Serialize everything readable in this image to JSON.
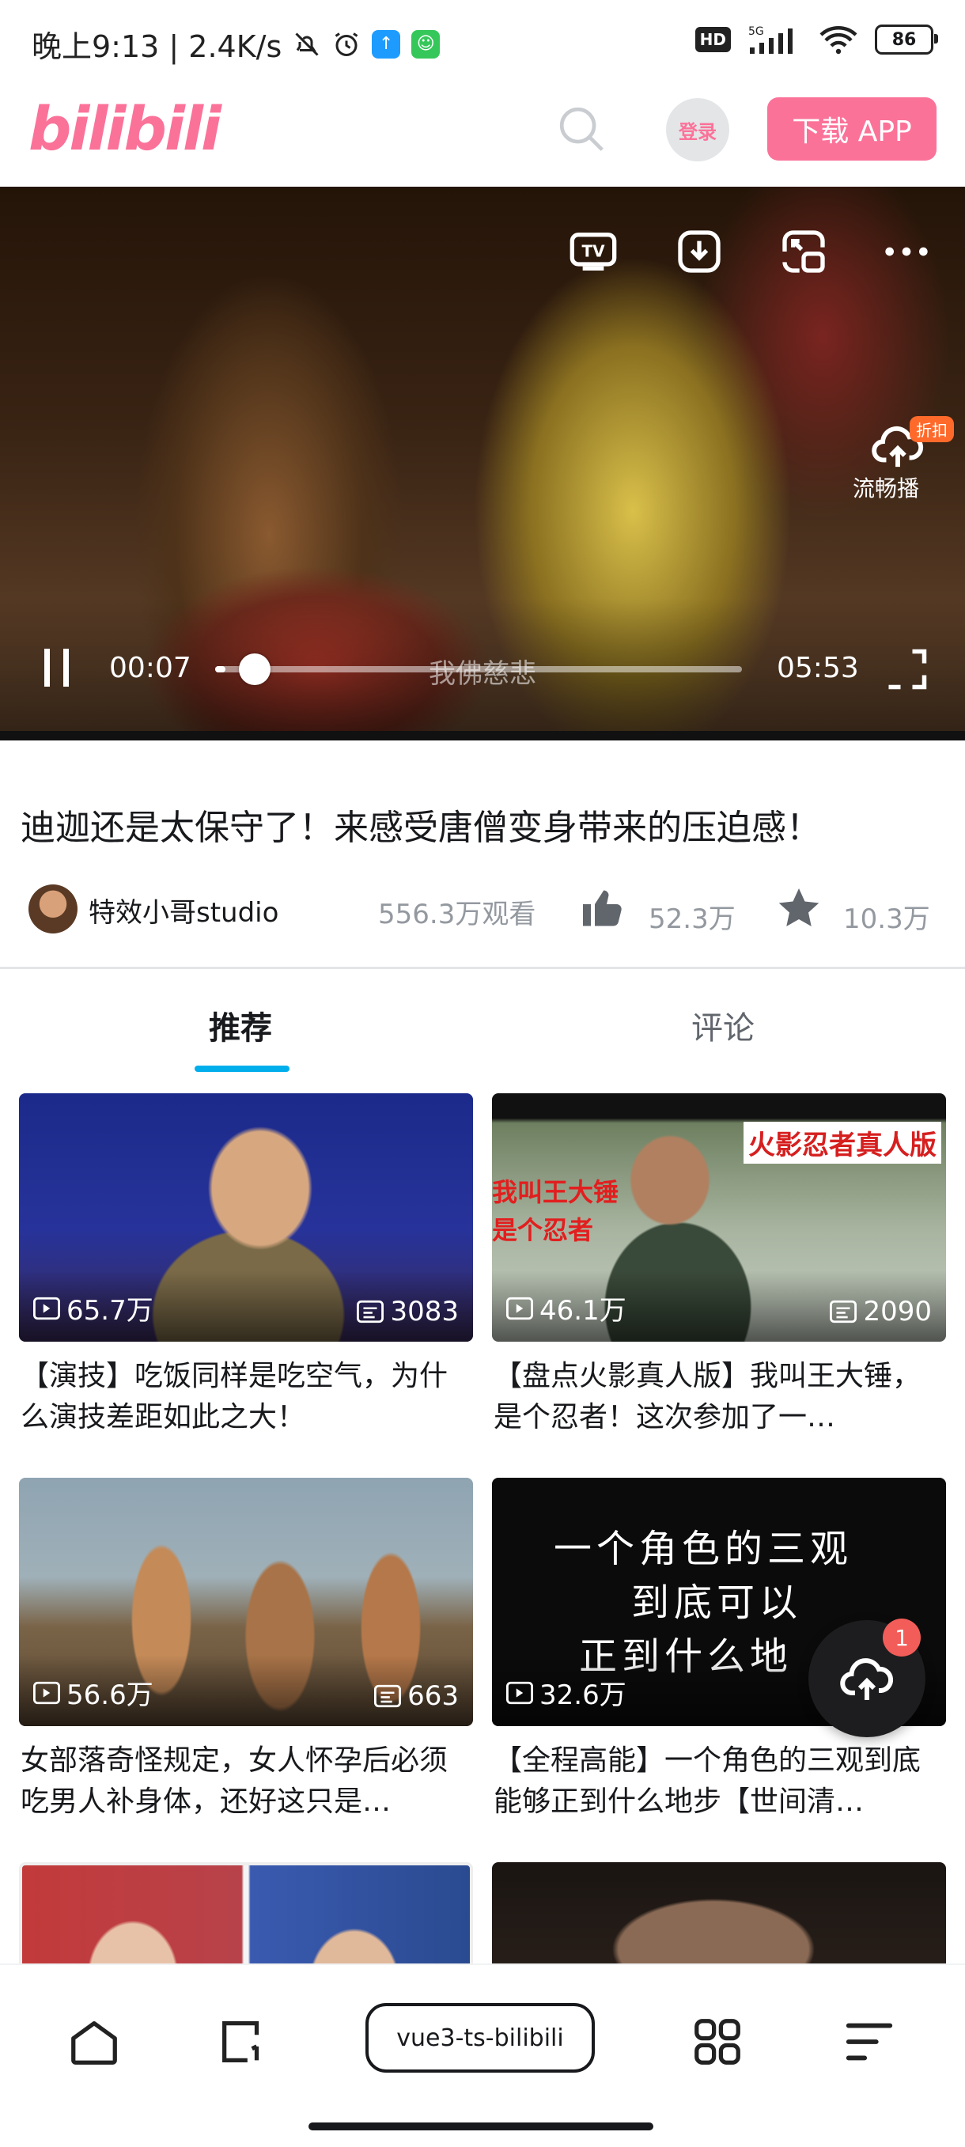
{
  "status_bar": {
    "time_speed": "晚上9:13 | 2.4K/s",
    "network": "5G",
    "hd": "HD",
    "battery": "86",
    "icons": [
      "bell-off-icon",
      "alarm-icon",
      "app-upload-icon",
      "app-bot-icon",
      "signal-icon",
      "wifi-icon",
      "battery-icon"
    ]
  },
  "header": {
    "logo": "bilibili",
    "login_label": "登录",
    "download_label": "下载 APP"
  },
  "player": {
    "current_time": "00:07",
    "total_time": "05:53",
    "subtitle": "我佛慈悲",
    "progress": 0.02,
    "smooth_play_label": "流畅播",
    "discount_badge": "折扣",
    "icons": [
      "tv-icon",
      "download-icon",
      "picture-in-picture-icon",
      "more-icon",
      "cloud-upload-icon",
      "pause-icon",
      "fullscreen-icon"
    ]
  },
  "video": {
    "title": "迪迦还是太保守了！来感受唐僧变身带来的压迫感！",
    "author": "特效小哥studio",
    "views": "556.3万观看",
    "likes": "52.3万",
    "favorites": "10.3万"
  },
  "tabs": [
    {
      "label": "推荐",
      "active": true
    },
    {
      "label": "评论",
      "active": false
    }
  ],
  "cards": [
    {
      "plays": "65.7万",
      "danmaku": "3083",
      "title": "【演技】吃饭同样是吃空气，为什么演技差距如此之大！"
    },
    {
      "plays": "46.1万",
      "danmaku": "2090",
      "title": "【盘点火影真人版】我叫王大锤，是个忍者！这次参加了一…",
      "overlay_top": "火影忍者真人版",
      "overlay_left_1": "我叫王大锤",
      "overlay_left_2": "是个忍者"
    },
    {
      "plays": "56.6万",
      "danmaku": "663",
      "title": "女部落奇怪规定，女人怀孕后必须吃男人补身体，还好这只是…"
    },
    {
      "plays": "32.6万",
      "danmaku": "",
      "title": "【全程高能】一个角色的三观到底能够正到什么地步【世间清…",
      "overlay_line_1": "一个角色的三观",
      "overlay_line_2": "到底可以",
      "overlay_line_3": "正到什么地"
    }
  ],
  "fab": {
    "badge": "1"
  },
  "bottom_nav": {
    "app_label": "vue3-ts-bilibili"
  },
  "colors": {
    "brand_pink": "#fb7299",
    "tab_indicator": "#00aeec",
    "badge_red": "#f25d59"
  }
}
